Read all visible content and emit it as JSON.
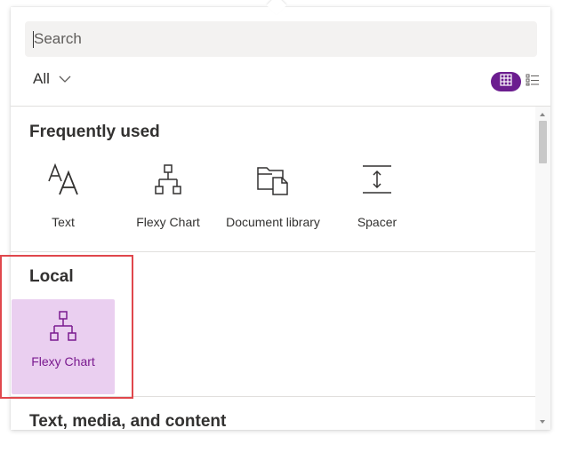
{
  "search": {
    "placeholder": "Search"
  },
  "filter": {
    "label": "All"
  },
  "view": {
    "active": "grid"
  },
  "sections": {
    "frequently_used": {
      "title": "Frequently used",
      "items": [
        {
          "label": "Text",
          "icon": "text-icon"
        },
        {
          "label": "Flexy Chart",
          "icon": "org-chart-icon"
        },
        {
          "label": "Document library",
          "icon": "folder-doc-icon"
        },
        {
          "label": "Spacer",
          "icon": "spacer-icon"
        }
      ]
    },
    "local": {
      "title": "Local",
      "items": [
        {
          "label": "Flexy Chart",
          "icon": "org-chart-icon",
          "selected": true
        }
      ]
    },
    "text_media": {
      "title": "Text, media, and content"
    }
  },
  "colors": {
    "accent": "#6b1d8f",
    "selected_bg": "#eacff0",
    "highlight": "#e0474c"
  }
}
